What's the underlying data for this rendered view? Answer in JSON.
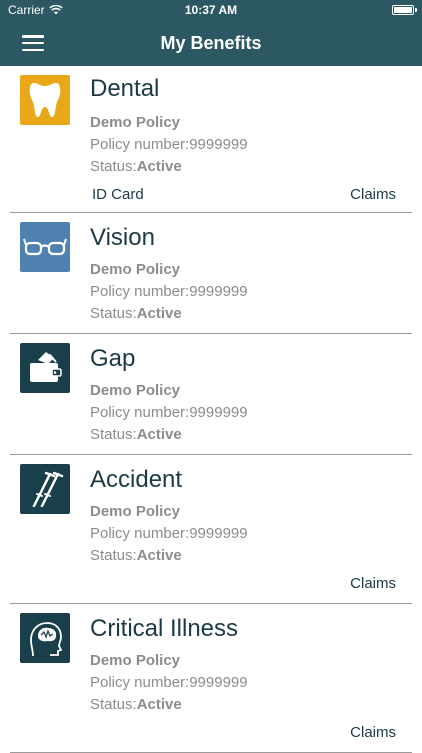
{
  "status_bar": {
    "carrier": "Carrier",
    "time": "10:37 AM"
  },
  "nav": {
    "title": "My Benefits"
  },
  "benefits": [
    {
      "title": "Dental",
      "icon": "tooth-icon",
      "icon_bg": "#e8a81a",
      "policy_name": "Demo Policy",
      "policy_label": "Policy number:",
      "policy_number": "9999999",
      "status_label": "Status:",
      "status_value": "Active",
      "id_card": "ID Card",
      "claims": "Claims"
    },
    {
      "title": "Vision",
      "icon": "glasses-icon",
      "icon_bg": "#4f81b2",
      "policy_name": "Demo Policy",
      "policy_label": "Policy number:",
      "policy_number": "9999999",
      "status_label": "Status:",
      "status_value": "Active"
    },
    {
      "title": "Gap",
      "icon": "wallet-icon",
      "icon_bg": "#183f4a",
      "policy_name": "Demo Policy",
      "policy_label": "Policy number:",
      "policy_number": "9999999",
      "status_label": "Status:",
      "status_value": "Active"
    },
    {
      "title": "Accident",
      "icon": "crutches-icon",
      "icon_bg": "#183f4a",
      "policy_name": "Demo Policy",
      "policy_label": "Policy number:",
      "policy_number": "9999999",
      "status_label": "Status:",
      "status_value": "Active",
      "claims": "Claims"
    },
    {
      "title": "Critical Illness",
      "icon": "brain-icon",
      "icon_bg": "#183f4a",
      "policy_name": "Demo Policy",
      "policy_label": "Policy number:",
      "policy_number": "9999999",
      "status_label": "Status:",
      "status_value": "Active",
      "claims": "Claims"
    }
  ],
  "colors": {
    "nav_bg": "#2b5863",
    "title_text": "#1b3a45",
    "secondary_text": "#8c8c8c"
  }
}
